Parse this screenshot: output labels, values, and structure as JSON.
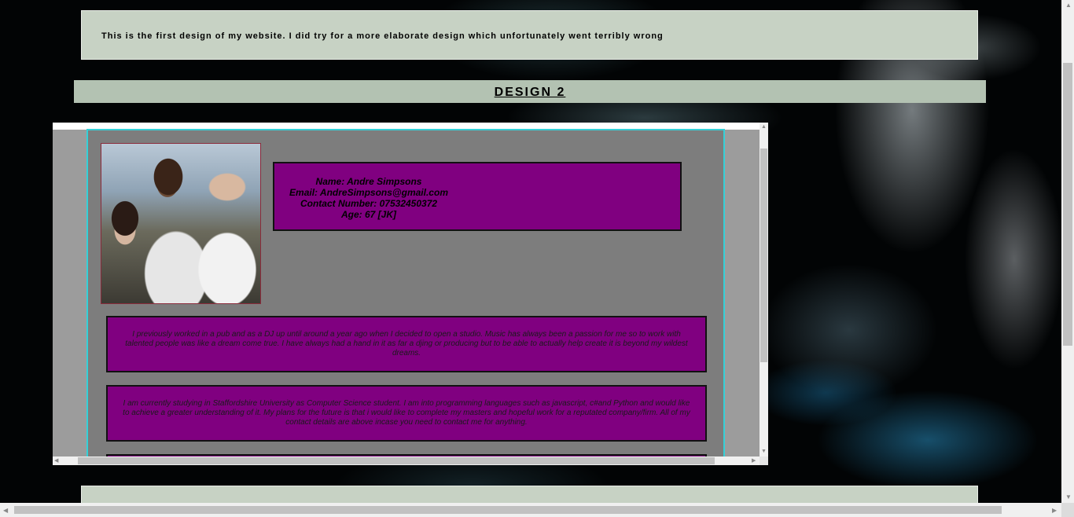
{
  "intro": {
    "text": "This is the first design of my website. I did try for a more elaborate design which unfortunately went terribly wrong"
  },
  "design": {
    "title": "DESIGN 2"
  },
  "profile": {
    "name": "Name: Andre Simpsons",
    "email": "Email: AndreSimpsons@gmail.com",
    "phone": "Contact Number: 07532450372",
    "age": "Age: 67 [JK]"
  },
  "paragraphs": [
    "I previously worked in a pub and as a DJ up until around a year ago when I decided to open a studio. Music has always been a passion for me so to work with talented people was like a dream come true. I have always had a hand in it as far a djing or producing but to be able to actually help create it is beyond my wildest dreams.",
    "I am currently studying in Staffordshire University as Computer Science student. I am into programming languages such as javascript, c#and Python and would like to achieve a greater understanding of it. My plans for the future is that i would like to complete my masters and hopeful work for a reputated company/firm. All of my contact details are above incase you need to contact me for anything."
  ],
  "colors": {
    "panel": "#c7d2c4",
    "accent": "#800080",
    "frame_border": "#35d0d8"
  }
}
